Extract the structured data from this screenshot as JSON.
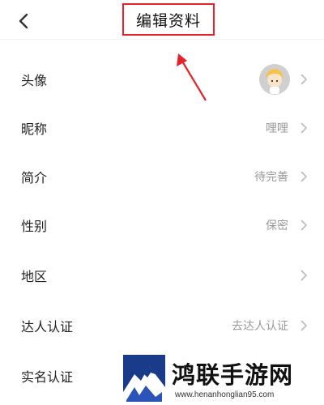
{
  "header": {
    "title": "编辑资料",
    "back_icon": "chevron-left-icon"
  },
  "rows": [
    {
      "label": "头像",
      "value": ""
    },
    {
      "label": "昵称",
      "value": "哩哩"
    },
    {
      "label": "简介",
      "value": "待完善"
    },
    {
      "label": "性别",
      "value": "保密"
    },
    {
      "label": "地区",
      "value": ""
    },
    {
      "label": "达人认证",
      "value": "去达人认证"
    },
    {
      "label": "实名认证",
      "value": ""
    }
  ],
  "annotation": {
    "color": "#e8222a"
  },
  "watermark": {
    "title": "鸿联手游网",
    "url": "www.henanhonglian95.com"
  }
}
